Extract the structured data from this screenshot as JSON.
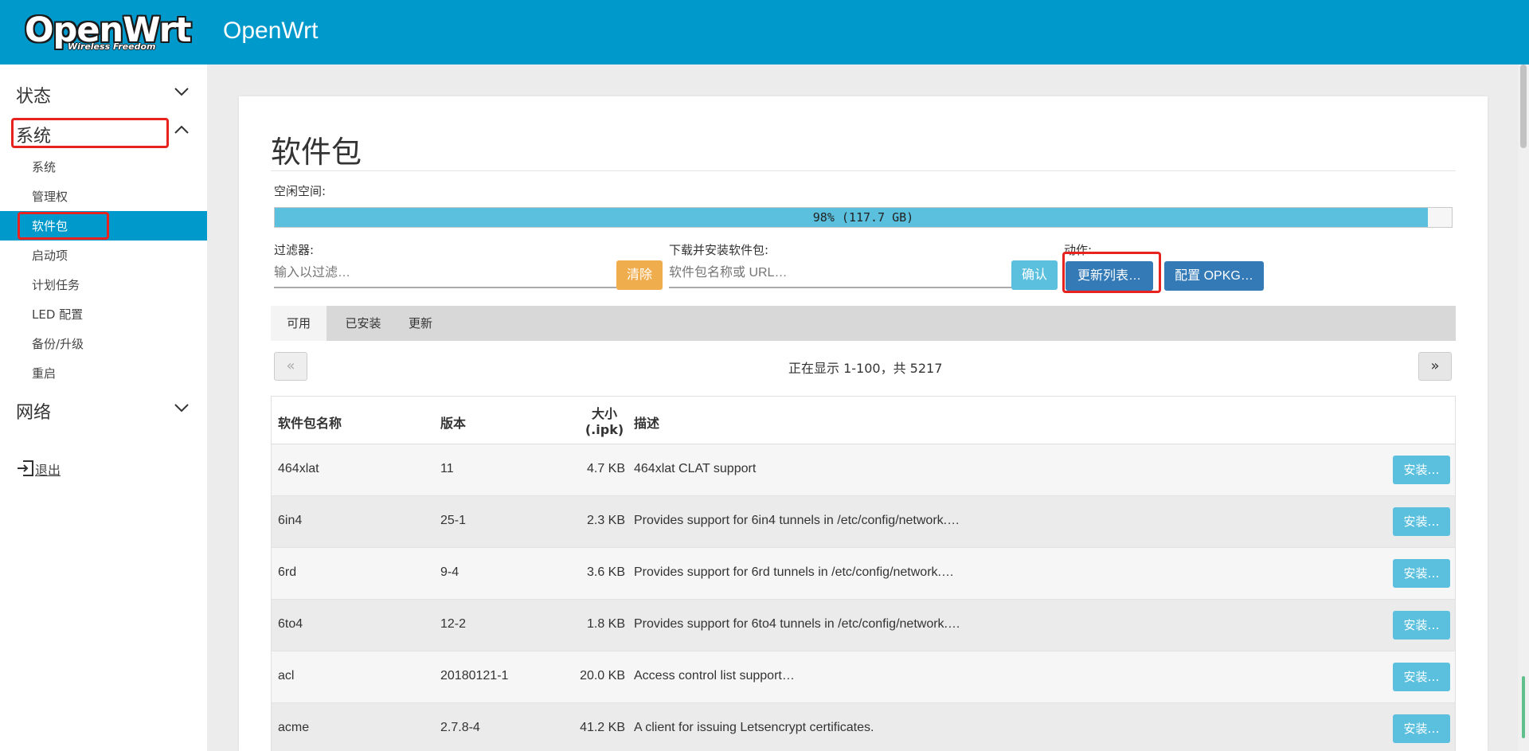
{
  "header": {
    "logo_text": "OpenWrt",
    "logo_tagline": "Wireless Freedom",
    "hostname": "OpenWrt"
  },
  "sidebar": {
    "categories": [
      {
        "label": "状态",
        "icon": "chevron-down-icon"
      },
      {
        "label": "系统",
        "icon": "chevron-up-icon"
      },
      {
        "label": "网络",
        "icon": "chevron-down-icon"
      }
    ],
    "system_items": [
      {
        "label": "系统"
      },
      {
        "label": "管理权"
      },
      {
        "label": "软件包"
      },
      {
        "label": "启动项"
      },
      {
        "label": "计划任务"
      },
      {
        "label": "LED 配置"
      },
      {
        "label": "备份/升级"
      },
      {
        "label": "重启"
      }
    ],
    "logout_label": "退出",
    "active_item": "软件包"
  },
  "page": {
    "title": "软件包",
    "free_space_label": "空闲空间:",
    "free_space_fraction": 0.98,
    "free_space_text": "98% (117.7 GB)",
    "filter_label": "过滤器:",
    "filter_placeholder": "输入以过滤…",
    "clear_button": "清除",
    "download_label": "下载并安装软件包:",
    "download_placeholder": "软件包名称或 URL…",
    "confirm_button": "确认",
    "actions_label": "动作:",
    "update_lists_button": "更新列表…",
    "configure_opkg_button": "配置 OPKG…"
  },
  "tabs": [
    {
      "label": "可用",
      "active": true
    },
    {
      "label": "已安装",
      "active": false
    },
    {
      "label": "更新",
      "active": false
    }
  ],
  "pager": {
    "prev": "«",
    "next": "»",
    "status": "正在显示 1-100，共 5217"
  },
  "table": {
    "headers": {
      "name": "软件包名称",
      "version": "版本",
      "size_line1": "大小",
      "size_line2": "(.ipk)",
      "description": "描述"
    },
    "install_label": "安装…",
    "rows": [
      {
        "name": "464xlat",
        "version": "11",
        "size": "4.7 KB",
        "description": "464xlat CLAT support"
      },
      {
        "name": "6in4",
        "version": "25-1",
        "size": "2.3 KB",
        "description": "Provides support for 6in4 tunnels in /etc/config/network.…"
      },
      {
        "name": "6rd",
        "version": "9-4",
        "size": "3.6 KB",
        "description": "Provides support for 6rd tunnels in /etc/config/network.…"
      },
      {
        "name": "6to4",
        "version": "12-2",
        "size": "1.8 KB",
        "description": "Provides support for 6to4 tunnels in /etc/config/network.…"
      },
      {
        "name": "acl",
        "version": "20180121-1",
        "size": "20.0 KB",
        "description": "Access control list support…"
      },
      {
        "name": "acme",
        "version": "2.7.8-4",
        "size": "41.2 KB",
        "description": "A client for issuing Letsencrypt certificates."
      }
    ]
  },
  "colors": {
    "brand": "#0099cc",
    "highlight": "#e8231f",
    "progress": "#5bc0de",
    "primary_button": "#337ab7",
    "warning_button": "#f0ad4e"
  }
}
